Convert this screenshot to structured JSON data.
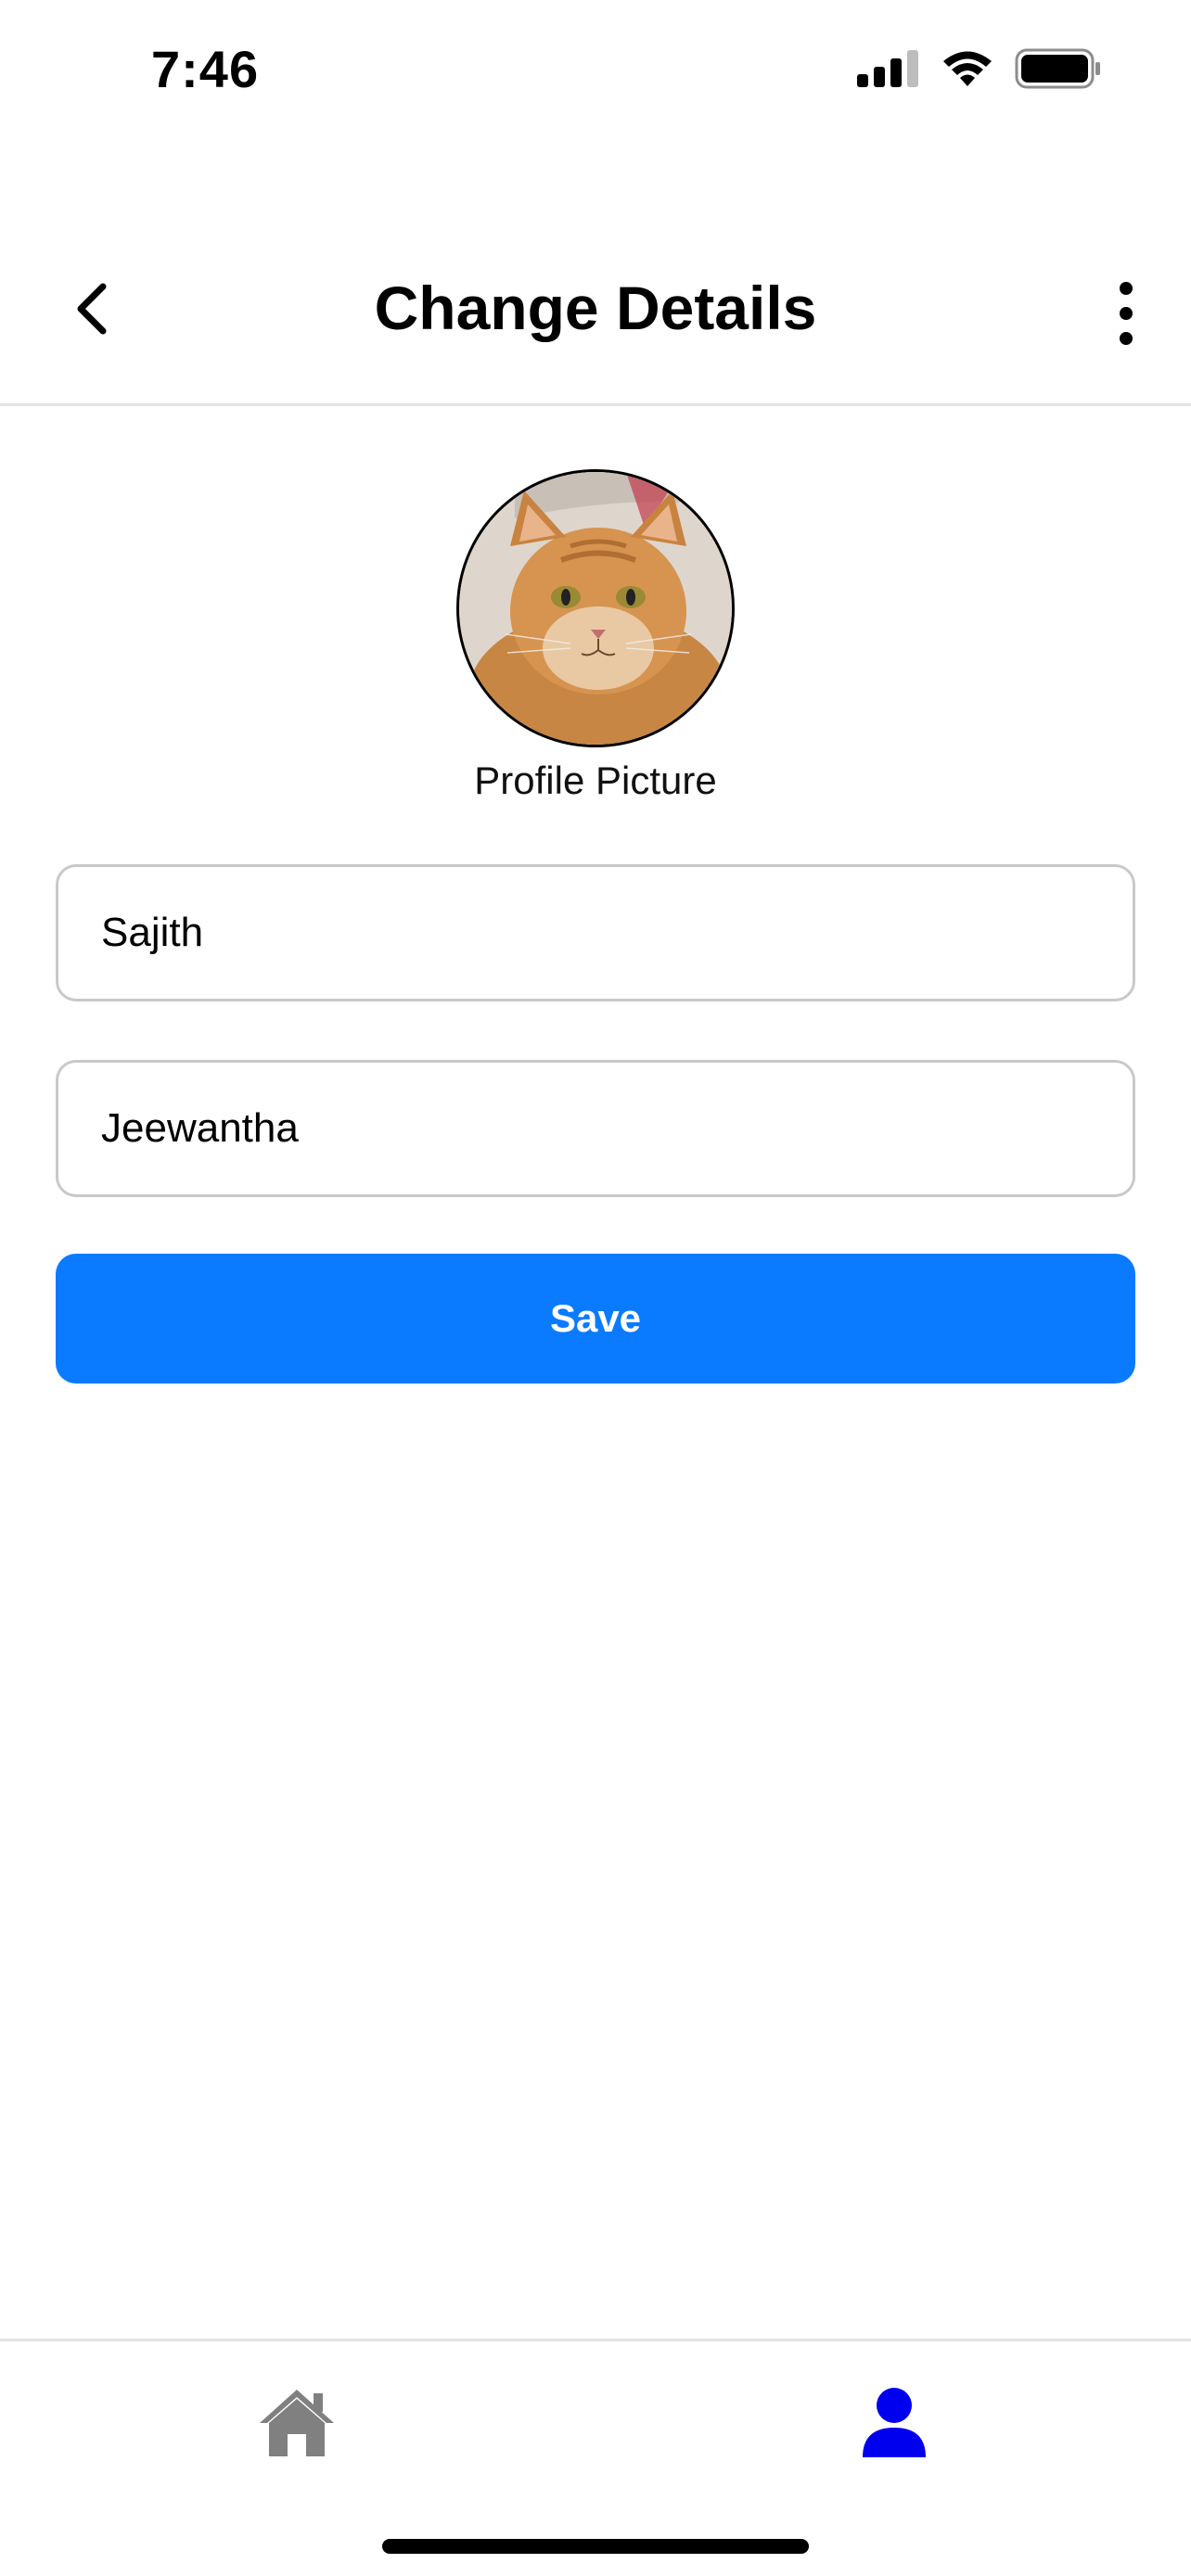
{
  "status_bar": {
    "time": "7:46",
    "icons": [
      "signal-icon",
      "wifi-icon",
      "battery-icon"
    ]
  },
  "header": {
    "title": "Change Details",
    "back_icon": "chevron-left-icon",
    "more_icon": "more-vertical-icon"
  },
  "profile": {
    "picture_label": "Profile Picture"
  },
  "form": {
    "first_name_value": "Sajith",
    "last_name_value": "Jeewantha",
    "save_label": "Save"
  },
  "tab_bar": {
    "items": [
      {
        "icon": "home-icon",
        "active": false
      },
      {
        "icon": "user-icon",
        "active": true
      }
    ]
  },
  "colors": {
    "accent": "#0a7bff",
    "active_tab": "#0000ee",
    "inactive_tab": "#808080"
  }
}
